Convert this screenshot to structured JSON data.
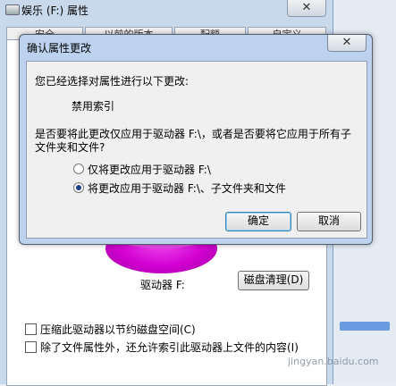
{
  "background_window": {
    "title": "娱乐 (F:) 属性",
    "close_glyph": "✕",
    "tabs": [
      "安全",
      "以前的版本",
      "配额",
      "自定义"
    ],
    "drive_label": "驱动器 F:",
    "cleanup_button": "磁盘清理(D)",
    "checkbox_compress": "压缩此驱动器以节约磁盘空间(C)",
    "checkbox_index": "除了文件属性外，还允许索引此驱动器上文件的内容(I)",
    "pie_color": "#d200d2"
  },
  "dialog": {
    "title": "确认属性更改",
    "close_glyph": "✕",
    "intro": "您已经选择对属性进行以下更改:",
    "change_item": "禁用索引",
    "question_line1": "是否要将此更改仅应用于驱动器 F:\\，或者是否要将它应用于所有子",
    "question_line2": "文件夹和文件?",
    "option_drive_only": "仅将更改应用于驱动器 F:\\",
    "option_all": "将更改应用于驱动器 F:\\、子文件夹和文件",
    "ok_button": "确定",
    "cancel_button": "取消"
  },
  "watermark": "jingyan.baidu.com"
}
